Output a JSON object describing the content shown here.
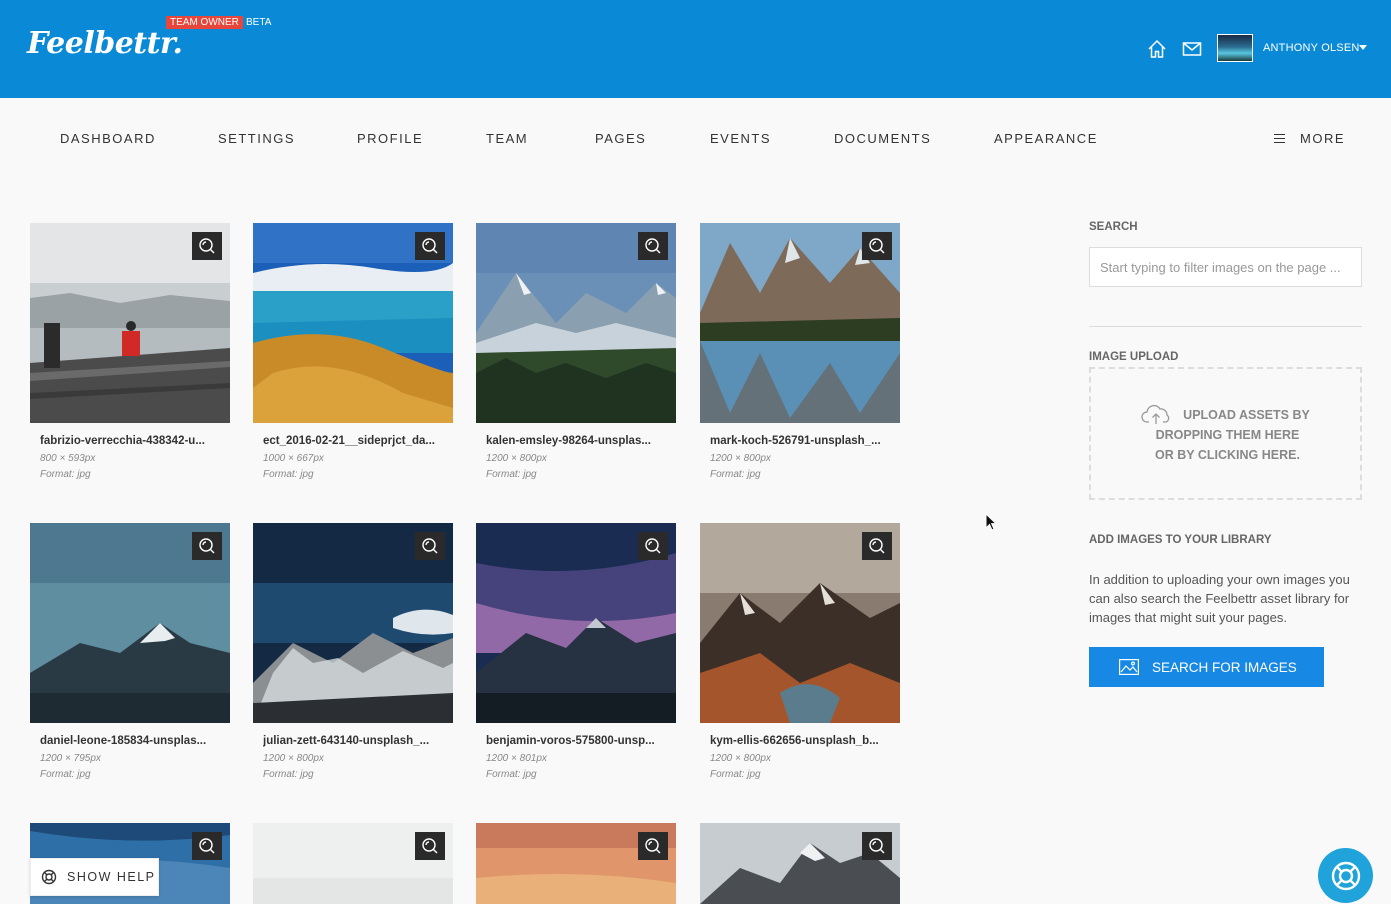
{
  "app": {
    "logo": "Feelbettr.",
    "badge_owner": "TEAM OWNER",
    "badge_beta": "BETA"
  },
  "header": {
    "user_name": "ANTHONY OLSEN",
    "icons": [
      "home-icon",
      "mail-icon"
    ]
  },
  "nav": {
    "items": [
      {
        "label": "DASHBOARD"
      },
      {
        "label": "SETTINGS"
      },
      {
        "label": "PROFILE"
      },
      {
        "label": "TEAM"
      },
      {
        "label": "PAGES"
      },
      {
        "label": "EVENTS"
      },
      {
        "label": "DOCUMENTS"
      },
      {
        "label": "APPEARANCE"
      }
    ],
    "more_label": "MORE"
  },
  "images": [
    {
      "name": "fabrizio-verrecchia-438342-u...",
      "dims": "800 × 593px",
      "format": "Format: jpg"
    },
    {
      "name": "ect_2016-02-21__sideprjct_da...",
      "dims": "1000 × 667px",
      "format": "Format: jpg"
    },
    {
      "name": "kalen-emsley-98264-unsplas...",
      "dims": "1200 × 800px",
      "format": "Format: jpg"
    },
    {
      "name": "mark-koch-526791-unsplash_...",
      "dims": "1200 × 800px",
      "format": "Format: jpg"
    },
    {
      "name": "daniel-leone-185834-unsplas...",
      "dims": "1200 × 795px",
      "format": "Format: jpg"
    },
    {
      "name": "julian-zett-643140-unsplash_...",
      "dims": "1200 × 800px",
      "format": "Format: jpg"
    },
    {
      "name": "benjamin-voros-575800-unsp...",
      "dims": "1200 × 801px",
      "format": "Format: jpg"
    },
    {
      "name": "kym-ellis-662656-unsplash_b...",
      "dims": "1200 × 800px",
      "format": "Format: jpg"
    }
  ],
  "sidebar": {
    "search_label": "SEARCH",
    "search_placeholder": "Start typing to filter images on the page ...",
    "upload_label": "IMAGE UPLOAD",
    "upload_line1": "UPLOAD ASSETS BY",
    "upload_line2": "DROPPING THEM HERE",
    "upload_line3": "OR BY CLICKING HERE.",
    "library_label": "ADD IMAGES TO YOUR LIBRARY",
    "library_text": "In addition to uploading your own images you can also search the Feelbettr asset library for images that might suit your pages.",
    "search_button": "SEARCH FOR IMAGES"
  },
  "help": {
    "label": "SHOW HELP"
  },
  "colors": {
    "header_bg": "#0a8ad6",
    "badge_red": "#e8463b",
    "button_blue": "#1788e4",
    "help_circle": "#1fa3da"
  }
}
